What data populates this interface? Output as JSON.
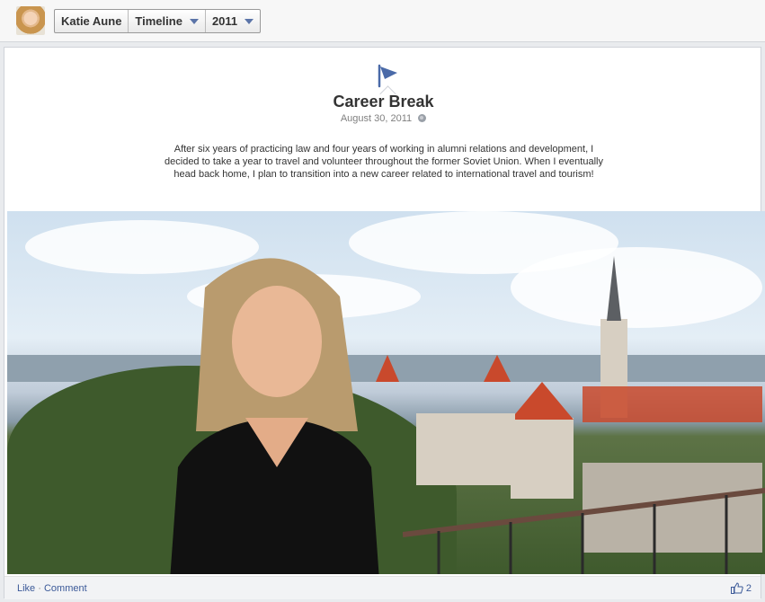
{
  "header": {
    "name": "Katie Aune",
    "view": "Timeline",
    "year": "2011"
  },
  "story": {
    "icon": "flag-icon",
    "title": "Career Break",
    "date": "August 30, 2011",
    "privacy_icon": "globe-icon",
    "text": "After six years of practicing law and four years of working in alumni relations and development, I decided to take a year to travel and volunteer throughout the former Soviet Union. When I eventually head back home, I plan to transition into a new career related to international travel and tourism!"
  },
  "footer": {
    "like_label": "Like",
    "separator": "·",
    "comment_label": "Comment",
    "like_count": "2"
  },
  "colors": {
    "link": "#3b5998",
    "flag": "#4a6aa8"
  }
}
